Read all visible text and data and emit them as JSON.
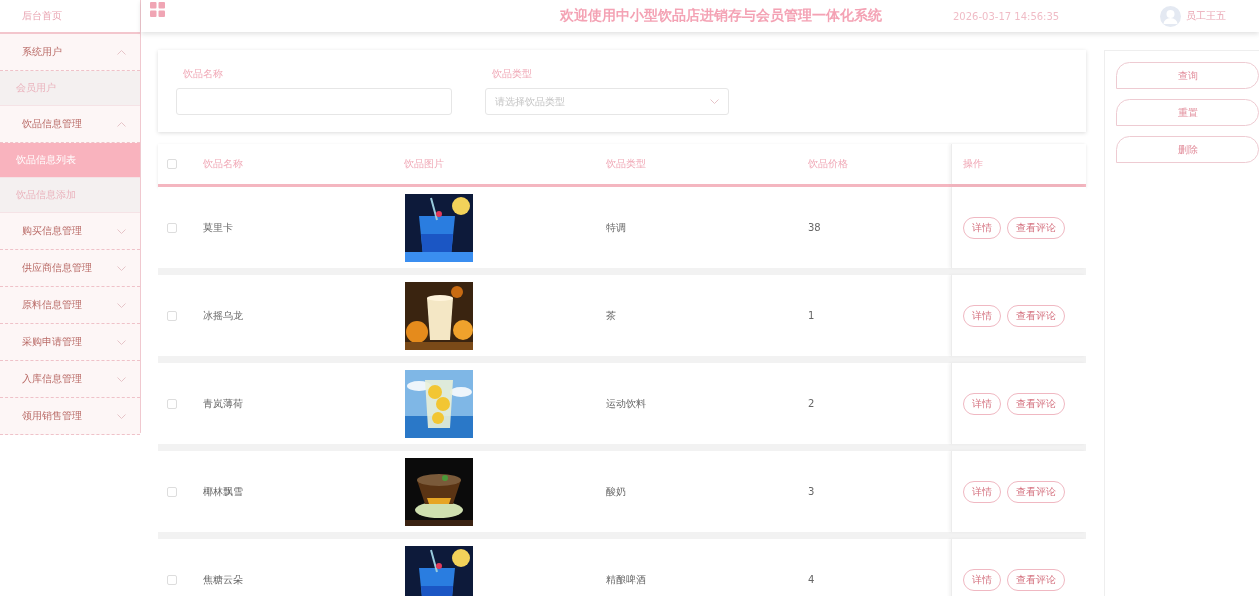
{
  "sidebar": {
    "home": "后台首页",
    "groups": [
      {
        "label": "系统用户",
        "expanded": true,
        "children": [
          {
            "label": "会员用户",
            "selected": false
          }
        ]
      },
      {
        "label": "饮品信息管理",
        "expanded": true,
        "children": [
          {
            "label": "饮品信息列表",
            "selected": true
          },
          {
            "label": "饮品信息添加",
            "selected": false
          }
        ]
      },
      {
        "label": "购买信息管理",
        "expanded": false
      },
      {
        "label": "供应商信息管理",
        "expanded": false
      },
      {
        "label": "原料信息管理",
        "expanded": false
      },
      {
        "label": "采购申请管理",
        "expanded": false
      },
      {
        "label": "入库信息管理",
        "expanded": false
      },
      {
        "label": "领用销售管理",
        "expanded": false
      }
    ]
  },
  "header": {
    "title": "欢迎使用中小型饮品店进销存与会员管理一体化系统",
    "datetime": "2026-03-17 14:56:35",
    "user": "员工王五"
  },
  "search": {
    "fields": [
      {
        "kind": "text",
        "label": "饮品名称"
      },
      {
        "kind": "select",
        "label": "饮品类型",
        "placeholder": "请选择饮品类型"
      }
    ]
  },
  "table": {
    "select_all_checked": false,
    "columns": [
      "饮品名称",
      "饮品图片",
      "饮品类型",
      "饮品价格",
      "操作"
    ],
    "rows": [
      {
        "checked": false,
        "name": "莫里卡",
        "image": {
          "kind": "picture"
        },
        "type": "特调",
        "price": "38",
        "actions": [
          "详情",
          "查看评论"
        ]
      },
      {
        "checked": false,
        "name": "冰摇乌龙",
        "image": {
          "kind": "picture"
        },
        "type": "茶",
        "price": "1",
        "actions": [
          "详情",
          "查看评论"
        ]
      },
      {
        "checked": false,
        "name": "青岚薄荷",
        "image": {
          "kind": "picture"
        },
        "type": "运动饮料",
        "price": "2",
        "actions": [
          "详情",
          "查看评论"
        ]
      },
      {
        "checked": false,
        "name": "椰林飘雪",
        "image": {
          "kind": "picture"
        },
        "type": "酸奶",
        "price": "3",
        "actions": [
          "详情",
          "查看评论"
        ]
      },
      {
        "checked": false,
        "name": "焦糖云朵",
        "image": {
          "kind": "picture"
        },
        "type": "精酿啤酒",
        "price": "4",
        "actions": [
          "详情",
          "查看评论"
        ]
      }
    ]
  },
  "buttons": [
    "查询",
    "重置",
    "删除"
  ]
}
